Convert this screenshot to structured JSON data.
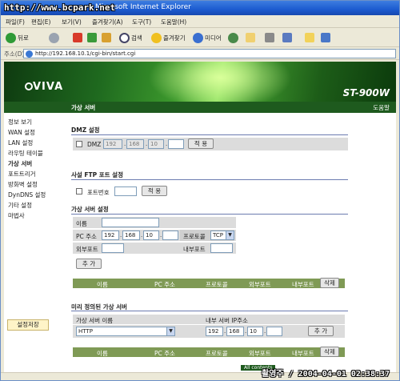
{
  "window": {
    "title": "Microsoft Internet Explorer",
    "watermark_top": "http://www.bcpark.net",
    "watermark_bottom": "촬영주 / 2004-04-01 02:38:37"
  },
  "menu": [
    "파일(F)",
    "편집(E)",
    "보기(V)",
    "즐겨찾기(A)",
    "도구(T)",
    "도움말(H)"
  ],
  "toolbar": {
    "back": "뒤로",
    "search": "검색",
    "favorites": "즐겨찾기",
    "media": "미디어"
  },
  "address": {
    "label": "주소(D)",
    "url": "http://192.168.10.1/cgi-bin/start.cgi"
  },
  "banner": {
    "logo": "VIVA",
    "model": "ST-900W"
  },
  "nav": {
    "current": "가상 서버",
    "help": "도움말"
  },
  "sidebar": {
    "items": [
      "정보 보기",
      "WAN 설정",
      "LAN 설정",
      "라우팅 테이블",
      "가상 서버",
      "포트트리거",
      "방화벽 설정",
      "DynDNS 설정",
      "기타 설정",
      "마법사"
    ],
    "save": "설정저장"
  },
  "dmz": {
    "title": "DMZ 설정",
    "label": "DMZ",
    "ip": [
      "192",
      "168",
      "10",
      ""
    ],
    "apply": "적 용"
  },
  "ftp": {
    "title": "사설 FTP 포트 설정",
    "label": "포트번호",
    "port": "",
    "apply": "적 용"
  },
  "vserver": {
    "title": "가상 서버 설정",
    "name_label": "이름",
    "name_value": "",
    "pc_label": "PC 주소",
    "ip": [
      "192",
      "168",
      "10",
      ""
    ],
    "proto_label": "프로토콜",
    "proto_value": "TCP",
    "ext_label": "외부포트",
    "ext_value": "",
    "int_label": "내부포트",
    "int_value": "",
    "add": "추 가"
  },
  "table": {
    "headers": [
      "이름",
      "PC 주소",
      "프로토콜",
      "외부포트",
      "내부포트"
    ],
    "delete": "삭제"
  },
  "predefined": {
    "title": "미리 정의된 가상 서버",
    "name_header": "가상 서버 이름",
    "ip_header": "내부 서버 IP주소",
    "selected": "HTTP",
    "ip": [
      "192",
      "168",
      "10",
      ""
    ],
    "add": "추 가"
  },
  "table2": {
    "headers": [
      "이름",
      "PC 주소",
      "프로토콜",
      "외부포트",
      "내부포트"
    ],
    "delete": "삭제"
  },
  "footer": "All contents"
}
